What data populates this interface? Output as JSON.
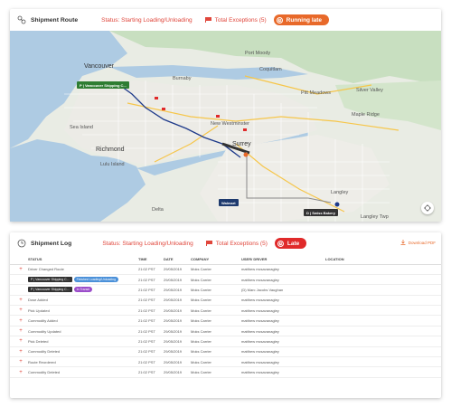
{
  "route": {
    "title": "Shipment Route",
    "status_prefix": "Status: ",
    "status_value": "Starting Loading/Unloading",
    "exceptions": "Total Exceptions (5)",
    "badge": "Running late",
    "badge_color": "#e8692a"
  },
  "map": {
    "cities": [
      "Vancouver",
      "Burnaby",
      "Coquitlam",
      "Richmond",
      "Surrey",
      "Delta",
      "Langley",
      "New Westminster",
      "Port Moody",
      "Maple Ridge",
      "Pitt Meadows",
      "Silver Valley",
      "Langley Twp"
    ],
    "stops": [
      {
        "label": "P | Vancouver Shipping C...",
        "color": "#2e7d32"
      },
      {
        "label": "Walmart",
        "color": "#1e3a6e"
      },
      {
        "label": "D | Swiss Bakery",
        "color": "#333333"
      }
    ],
    "labels": {
      "vancouver": "Vancouver",
      "burnaby": "Burnaby",
      "coquitlam": "Coquitlam",
      "richmond": "Richmond",
      "surrey": "Surrey",
      "delta": "Delta",
      "langley": "Langley",
      "new_westminster": "New Westminster",
      "port_moody": "Port Moody",
      "maple_ridge": "Maple Ridge",
      "pitt_meadows": "Pitt Meadows",
      "silver_valley": "Silver Valley",
      "sea_island": "Sea Island",
      "lulu": "Lulu Island",
      "langley_twp": "Langley Twp"
    }
  },
  "log": {
    "title": "Shipment Log",
    "status_prefix": "Status: ",
    "status_value": "Starting Loading/Unloading",
    "exceptions": "Total Exceptions (5)",
    "badge": "Late",
    "badge_color": "#e02a2a",
    "download": "Download PDF",
    "columns": [
      "STATUS",
      "TIME",
      "DATE",
      "COMPANY",
      "USER/ DRIVER",
      "LOCATION"
    ],
    "rows": [
      {
        "ex": "+",
        "status": "Driver Changed Route",
        "time": "21:02 PST",
        "date": "29/05/2019",
        "company": "Moks Carrier",
        "user": "matthew mcsavanagley",
        "location": ""
      },
      {
        "ex": "",
        "status": "",
        "tags": [
          {
            "t": "P | Vancouver Shipping C...",
            "c": "dark"
          },
          {
            "t": "Finished Loading/Unloading",
            "c": "blue"
          }
        ],
        "time": "21:02 PST",
        "date": "29/05/2019",
        "company": "Moks Carrier",
        "user": "matthew mcsavanagley",
        "location": ""
      },
      {
        "ex": "",
        "status": "",
        "tags": [
          {
            "t": "P | Vancouver Shipping C...",
            "c": "dark"
          },
          {
            "t": "In Transit",
            "c": "purple"
          }
        ],
        "time": "21:02 PST",
        "date": "29/05/2019",
        "company": "Moks Carrier",
        "user": "(D) Marc Jacobs Vaughan",
        "location": ""
      },
      {
        "ex": "+",
        "status": "Dose Added",
        "time": "21:02 PST",
        "date": "29/05/2019",
        "company": "Moks Carrier",
        "user": "matthew mcsavanagley",
        "location": ""
      },
      {
        "ex": "+",
        "status": "Pick Updated",
        "time": "21:02 PST",
        "date": "29/05/2019",
        "company": "Moks Carrier",
        "user": "matthew mcsavanagley",
        "location": ""
      },
      {
        "ex": "+",
        "status": "Commodity Added",
        "time": "21:02 PST",
        "date": "29/05/2019",
        "company": "Moks Carrier",
        "user": "matthew mcsavanagley",
        "location": ""
      },
      {
        "ex": "+",
        "status": "Commodity Updated",
        "time": "21:02 PST",
        "date": "29/05/2019",
        "company": "Moks Carrier",
        "user": "matthew mcsavanagley",
        "location": ""
      },
      {
        "ex": "+",
        "status": "Pick Deleted",
        "time": "21:02 PST",
        "date": "29/05/2019",
        "company": "Moks Carrier",
        "user": "matthew mcsavanagley",
        "location": ""
      },
      {
        "ex": "+",
        "status": "Commodity Deleted",
        "time": "21:02 PST",
        "date": "29/05/2019",
        "company": "Moks Carrier",
        "user": "matthew mcsavanagley",
        "location": ""
      },
      {
        "ex": "+",
        "status": "Route Reordered",
        "time": "21:02 PST",
        "date": "29/05/2019",
        "company": "Moks Carrier",
        "user": "matthew mcsavanagley",
        "location": ""
      },
      {
        "ex": "+",
        "status": "Commodity Deleted",
        "time": "21:02 PST",
        "date": "29/05/2019",
        "company": "Moks Carrier",
        "user": "matthew mcsavanagley",
        "location": ""
      }
    ]
  }
}
